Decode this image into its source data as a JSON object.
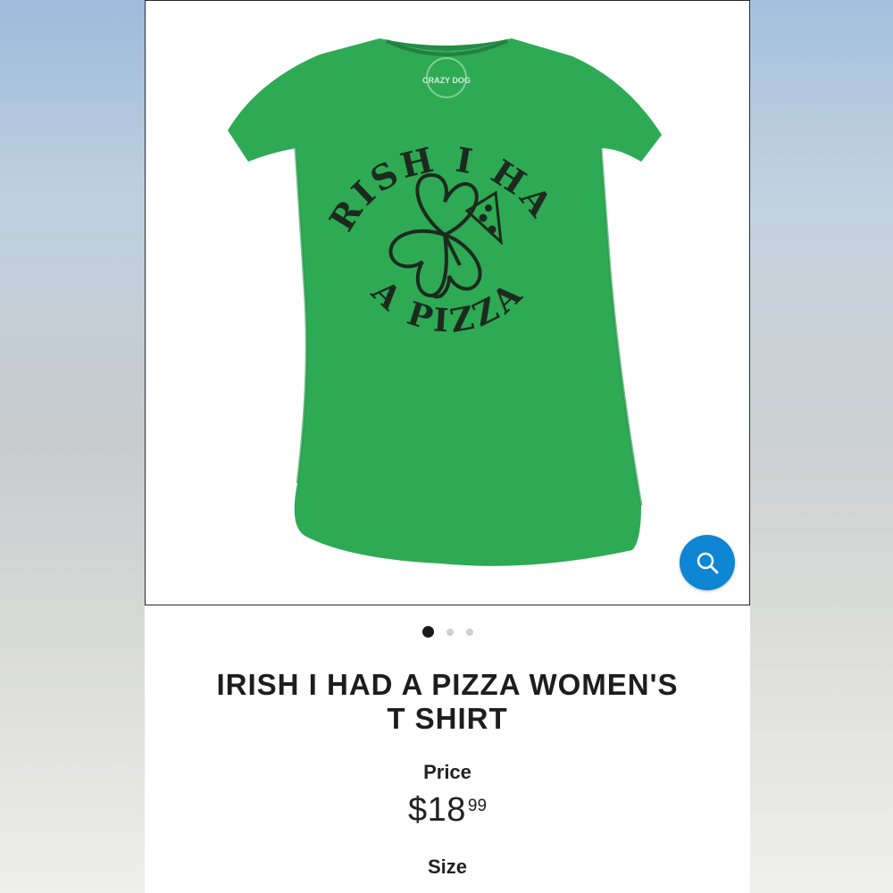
{
  "product": {
    "title": "IRISH I HAD A PIZZA WOMEN'S T SHIRT",
    "title_line1": "IRISH I HAD A PIZZA WOMEN'S",
    "title_line2": "T SHIRT",
    "price_label": "Price",
    "price_dollars": "$18",
    "price_cents": "99",
    "size_label": "Size"
  },
  "image": {
    "shirt_color": "#2faa55",
    "print_text_top": "IRISH I HAD",
    "print_text_bottom": "A PIZZA",
    "collar_logo": "CRAZY DOG"
  },
  "gallery": {
    "dot_count": 3,
    "active_index": 0
  },
  "zoom": {
    "icon": "search-icon",
    "color": "#0e86d4"
  }
}
